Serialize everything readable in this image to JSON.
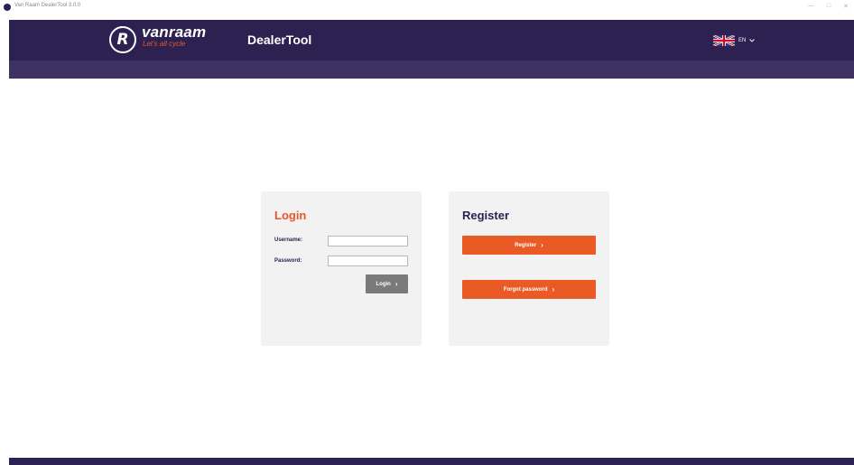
{
  "window": {
    "title": "Van Raam DealerTool 3.0.0",
    "controls": [
      "—",
      "□",
      "✕"
    ]
  },
  "header": {
    "logo_letter": "R",
    "brand_name": "vanraam",
    "tagline": "Let's all cycle",
    "app_title": "DealerTool",
    "language": {
      "code": "EN",
      "flag_icon": "uk-flag-icon",
      "dropdown_icon": "chevron-down-icon"
    }
  },
  "login": {
    "title": "Login",
    "username_label": "Username:",
    "username_value": "",
    "password_label": "Password:",
    "password_value": "",
    "button_label": "Login",
    "button_icon": "chevron-right-icon"
  },
  "register": {
    "title": "Register",
    "register_button_label": "Register",
    "forgot_button_label": "Forgot password",
    "button_icon": "chevron-right-icon"
  },
  "colors": {
    "brand_dark": "#2c2150",
    "accent_orange": "#ea5a25",
    "card_bg": "#f2f2f2",
    "button_grey": "#7a7a7a"
  }
}
